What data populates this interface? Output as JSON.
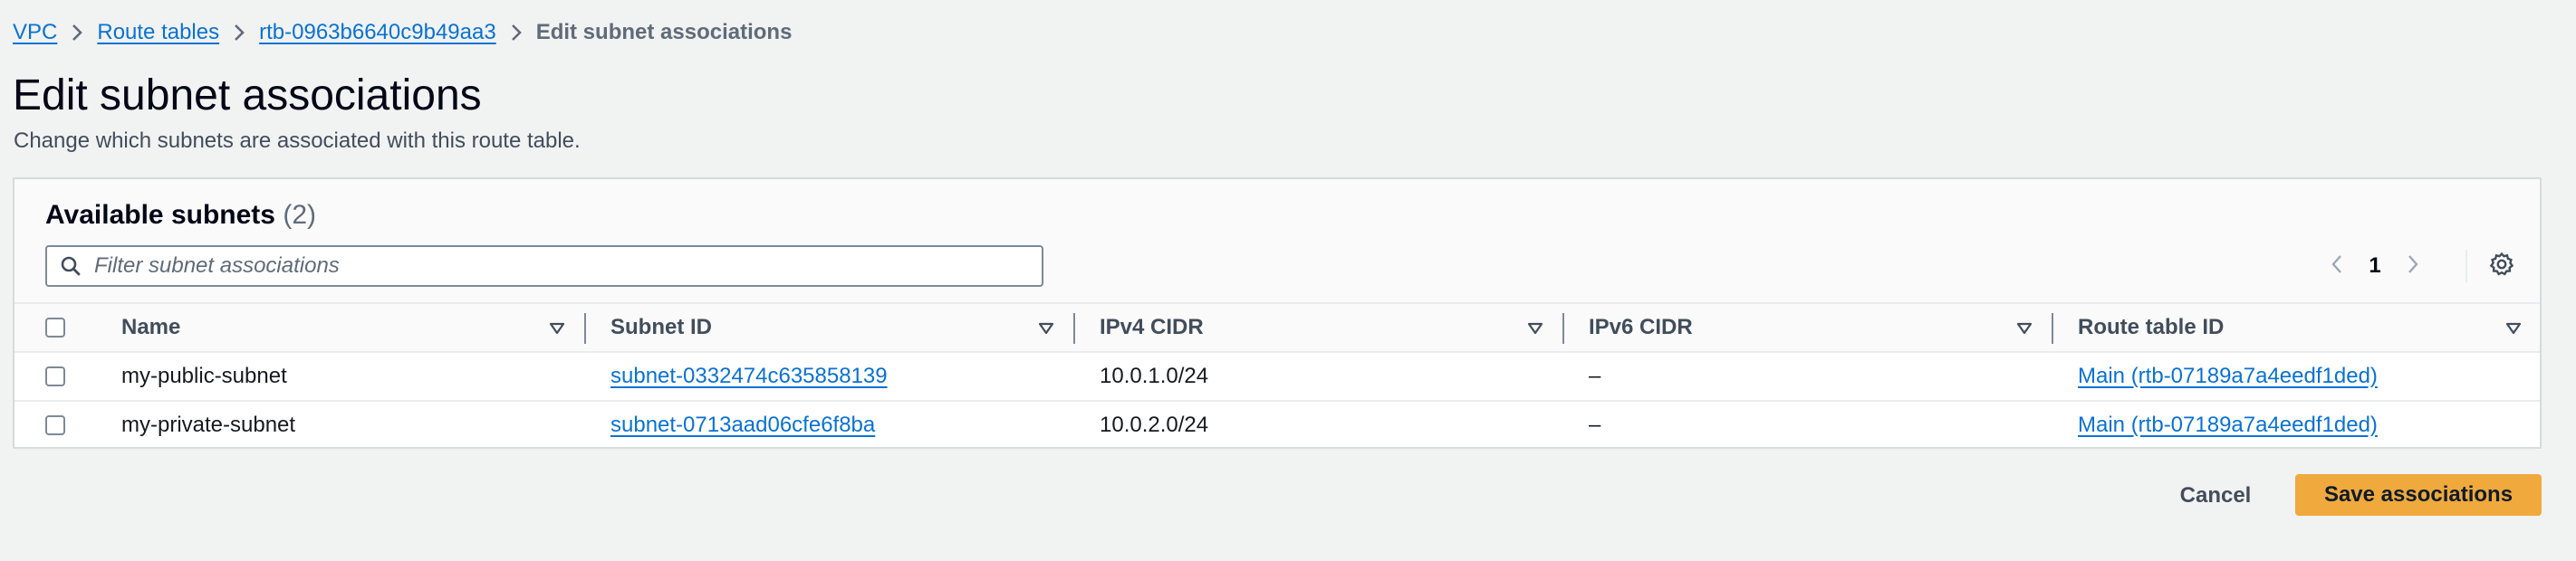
{
  "breadcrumb": {
    "items": [
      "VPC",
      "Route tables",
      "rtb-0963b6640c9b49aa3"
    ],
    "current": "Edit subnet associations"
  },
  "page": {
    "title": "Edit subnet associations",
    "description": "Change which subnets are associated with this route table."
  },
  "panel": {
    "title": "Available subnets",
    "count": "(2)",
    "filter_placeholder": "Filter subnet associations",
    "filter_value": "",
    "current_page": "1"
  },
  "table": {
    "columns": [
      "Name",
      "Subnet ID",
      "IPv4 CIDR",
      "IPv6 CIDR",
      "Route table ID"
    ],
    "rows": [
      {
        "checked": false,
        "name": "my-public-subnet",
        "subnet_id": "subnet-0332474c635858139",
        "ipv4": "10.0.1.0/24",
        "ipv6": "–",
        "route_table": "Main (rtb-07189a7a4eedf1ded)"
      },
      {
        "checked": false,
        "name": "my-private-subnet",
        "subnet_id": "subnet-0713aad06cfe6f8ba",
        "ipv4": "10.0.2.0/24",
        "ipv6": "–",
        "route_table": "Main (rtb-07189a7a4eedf1ded)"
      }
    ]
  },
  "actions": {
    "cancel": "Cancel",
    "save": "Save associations"
  },
  "colors": {
    "link": "#0972d3",
    "primary_button": "#f0a93c",
    "background": "#f1f2f2"
  },
  "icons": [
    "chevron-right-icon",
    "search-icon",
    "chevron-left-icon",
    "gear-icon",
    "sort-triangle-icon"
  ]
}
